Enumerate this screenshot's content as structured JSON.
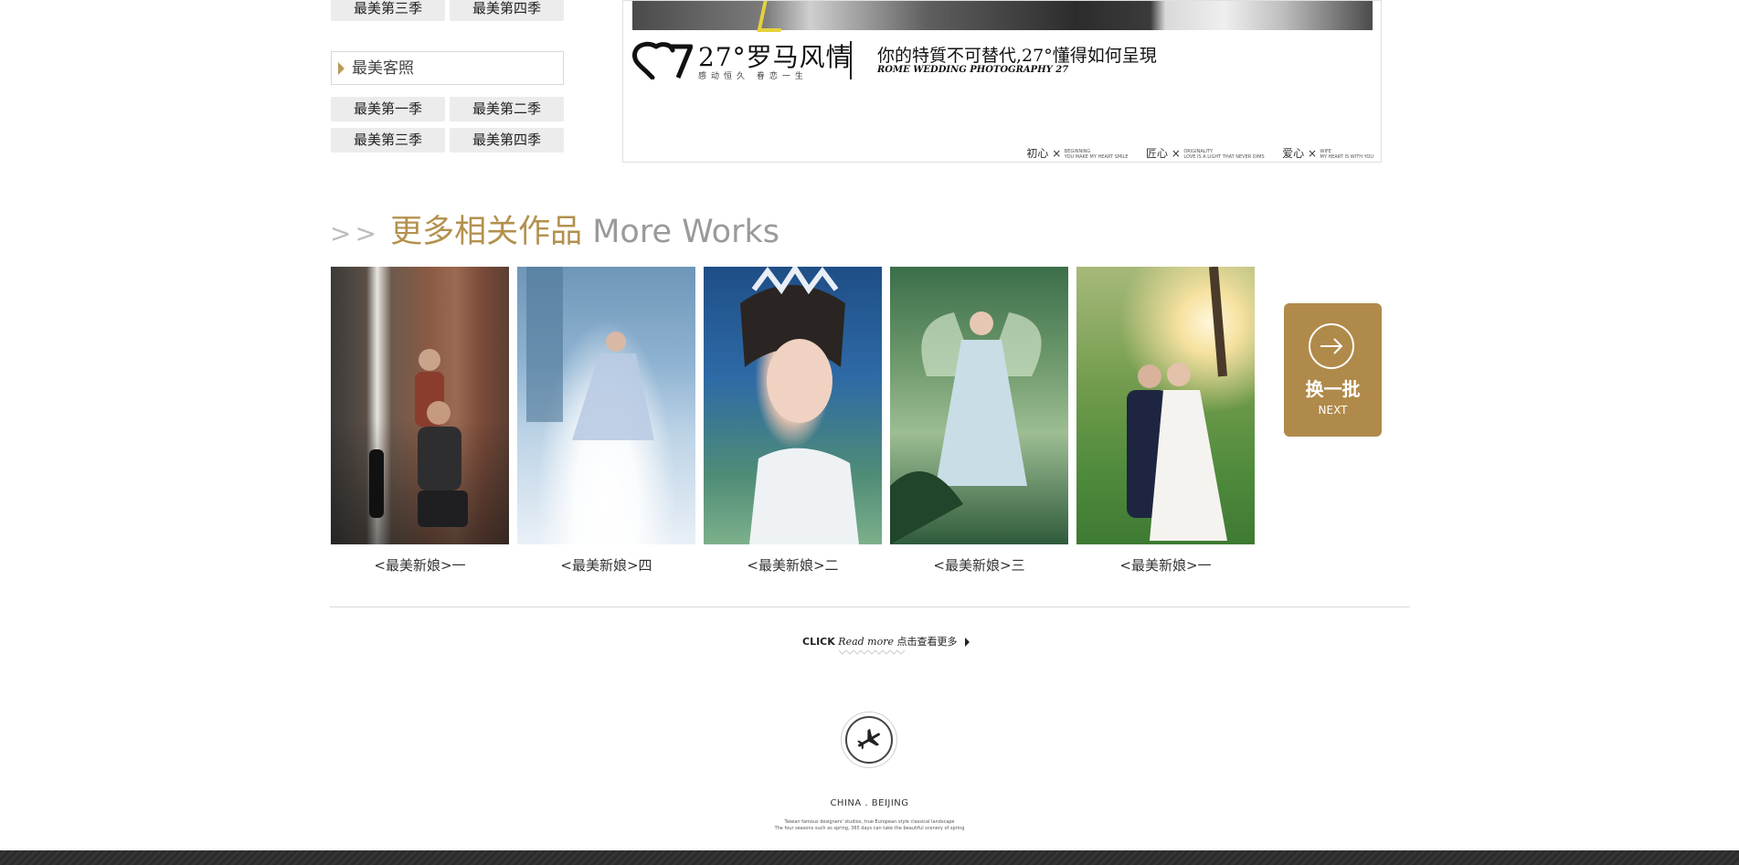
{
  "sidebar": {
    "top_row": [
      "最美第三季",
      "最美第四季"
    ],
    "section_title": "最美客照",
    "seasons": [
      "最美第一季",
      "最美第二季",
      "最美第三季",
      "最美第四季"
    ]
  },
  "banner": {
    "brand_name": "27°罗马风情",
    "brand_sub": "感动恒久  眷恋一生",
    "slogan": "你的特質不可替代,27°懂得如何呈現",
    "slogan_en": "ROME WEDDING PHOTOGRAPHY 27",
    "tags": [
      {
        "zh": "初心 ×",
        "small1": "BEGINNING",
        "small2": "YOU MAKE MY HEART SMILE"
      },
      {
        "zh": "匠心 ×",
        "small1": "ORIGINALITY",
        "small2": "LOVE IS A LIGHT THAT NEVER DIMS"
      },
      {
        "zh": "爱心 ×",
        "small1": "WIFE",
        "small2": "MY HEART IS WITH YOU"
      }
    ]
  },
  "more_works": {
    "arrows": ">>",
    "title_zh": "更多相关作品",
    "title_en": "More Works",
    "items": [
      {
        "caption": "<最美新娘>一"
      },
      {
        "caption": "<最美新娘>四"
      },
      {
        "caption": "<最美新娘>二"
      },
      {
        "caption": "<最美新娘>三"
      },
      {
        "caption": "<最美新娘>一"
      }
    ],
    "next_zh": "换一批",
    "next_en": "NEXT"
  },
  "read_more": {
    "click": "CLICK",
    "read_more": "Read more",
    "zh": "点击查看更多"
  },
  "footer": {
    "location": "CHINA . BEIJING",
    "line1": "Taiwan famous designers' studios, true European style classical landscape",
    "line2": "The four seasons such as spring, 365 days can take the beautiful scenery of spring"
  },
  "colors": {
    "accent": "#b08a4a",
    "heading_gold": "#b3914e",
    "footer_bar": "#2b2b2b"
  }
}
